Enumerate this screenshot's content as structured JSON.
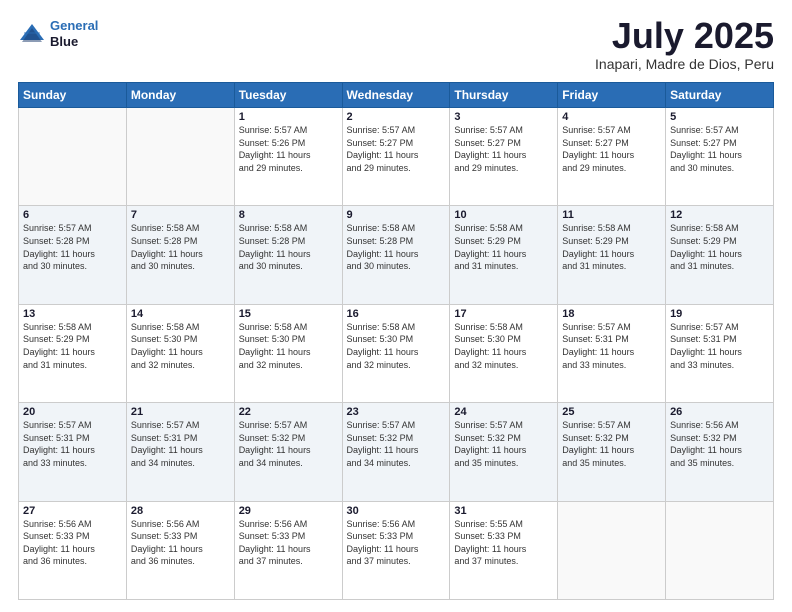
{
  "header": {
    "logo_line1": "General",
    "logo_line2": "Blue",
    "month_title": "July 2025",
    "location": "Inapari, Madre de Dios, Peru"
  },
  "weekdays": [
    "Sunday",
    "Monday",
    "Tuesday",
    "Wednesday",
    "Thursday",
    "Friday",
    "Saturday"
  ],
  "weeks": [
    [
      {
        "day": "",
        "info": ""
      },
      {
        "day": "",
        "info": ""
      },
      {
        "day": "1",
        "info": "Sunrise: 5:57 AM\nSunset: 5:26 PM\nDaylight: 11 hours\nand 29 minutes."
      },
      {
        "day": "2",
        "info": "Sunrise: 5:57 AM\nSunset: 5:27 PM\nDaylight: 11 hours\nand 29 minutes."
      },
      {
        "day": "3",
        "info": "Sunrise: 5:57 AM\nSunset: 5:27 PM\nDaylight: 11 hours\nand 29 minutes."
      },
      {
        "day": "4",
        "info": "Sunrise: 5:57 AM\nSunset: 5:27 PM\nDaylight: 11 hours\nand 29 minutes."
      },
      {
        "day": "5",
        "info": "Sunrise: 5:57 AM\nSunset: 5:27 PM\nDaylight: 11 hours\nand 30 minutes."
      }
    ],
    [
      {
        "day": "6",
        "info": "Sunrise: 5:57 AM\nSunset: 5:28 PM\nDaylight: 11 hours\nand 30 minutes."
      },
      {
        "day": "7",
        "info": "Sunrise: 5:58 AM\nSunset: 5:28 PM\nDaylight: 11 hours\nand 30 minutes."
      },
      {
        "day": "8",
        "info": "Sunrise: 5:58 AM\nSunset: 5:28 PM\nDaylight: 11 hours\nand 30 minutes."
      },
      {
        "day": "9",
        "info": "Sunrise: 5:58 AM\nSunset: 5:28 PM\nDaylight: 11 hours\nand 30 minutes."
      },
      {
        "day": "10",
        "info": "Sunrise: 5:58 AM\nSunset: 5:29 PM\nDaylight: 11 hours\nand 31 minutes."
      },
      {
        "day": "11",
        "info": "Sunrise: 5:58 AM\nSunset: 5:29 PM\nDaylight: 11 hours\nand 31 minutes."
      },
      {
        "day": "12",
        "info": "Sunrise: 5:58 AM\nSunset: 5:29 PM\nDaylight: 11 hours\nand 31 minutes."
      }
    ],
    [
      {
        "day": "13",
        "info": "Sunrise: 5:58 AM\nSunset: 5:29 PM\nDaylight: 11 hours\nand 31 minutes."
      },
      {
        "day": "14",
        "info": "Sunrise: 5:58 AM\nSunset: 5:30 PM\nDaylight: 11 hours\nand 32 minutes."
      },
      {
        "day": "15",
        "info": "Sunrise: 5:58 AM\nSunset: 5:30 PM\nDaylight: 11 hours\nand 32 minutes."
      },
      {
        "day": "16",
        "info": "Sunrise: 5:58 AM\nSunset: 5:30 PM\nDaylight: 11 hours\nand 32 minutes."
      },
      {
        "day": "17",
        "info": "Sunrise: 5:58 AM\nSunset: 5:30 PM\nDaylight: 11 hours\nand 32 minutes."
      },
      {
        "day": "18",
        "info": "Sunrise: 5:57 AM\nSunset: 5:31 PM\nDaylight: 11 hours\nand 33 minutes."
      },
      {
        "day": "19",
        "info": "Sunrise: 5:57 AM\nSunset: 5:31 PM\nDaylight: 11 hours\nand 33 minutes."
      }
    ],
    [
      {
        "day": "20",
        "info": "Sunrise: 5:57 AM\nSunset: 5:31 PM\nDaylight: 11 hours\nand 33 minutes."
      },
      {
        "day": "21",
        "info": "Sunrise: 5:57 AM\nSunset: 5:31 PM\nDaylight: 11 hours\nand 34 minutes."
      },
      {
        "day": "22",
        "info": "Sunrise: 5:57 AM\nSunset: 5:32 PM\nDaylight: 11 hours\nand 34 minutes."
      },
      {
        "day": "23",
        "info": "Sunrise: 5:57 AM\nSunset: 5:32 PM\nDaylight: 11 hours\nand 34 minutes."
      },
      {
        "day": "24",
        "info": "Sunrise: 5:57 AM\nSunset: 5:32 PM\nDaylight: 11 hours\nand 35 minutes."
      },
      {
        "day": "25",
        "info": "Sunrise: 5:57 AM\nSunset: 5:32 PM\nDaylight: 11 hours\nand 35 minutes."
      },
      {
        "day": "26",
        "info": "Sunrise: 5:56 AM\nSunset: 5:32 PM\nDaylight: 11 hours\nand 35 minutes."
      }
    ],
    [
      {
        "day": "27",
        "info": "Sunrise: 5:56 AM\nSunset: 5:33 PM\nDaylight: 11 hours\nand 36 minutes."
      },
      {
        "day": "28",
        "info": "Sunrise: 5:56 AM\nSunset: 5:33 PM\nDaylight: 11 hours\nand 36 minutes."
      },
      {
        "day": "29",
        "info": "Sunrise: 5:56 AM\nSunset: 5:33 PM\nDaylight: 11 hours\nand 37 minutes."
      },
      {
        "day": "30",
        "info": "Sunrise: 5:56 AM\nSunset: 5:33 PM\nDaylight: 11 hours\nand 37 minutes."
      },
      {
        "day": "31",
        "info": "Sunrise: 5:55 AM\nSunset: 5:33 PM\nDaylight: 11 hours\nand 37 minutes."
      },
      {
        "day": "",
        "info": ""
      },
      {
        "day": "",
        "info": ""
      }
    ]
  ]
}
